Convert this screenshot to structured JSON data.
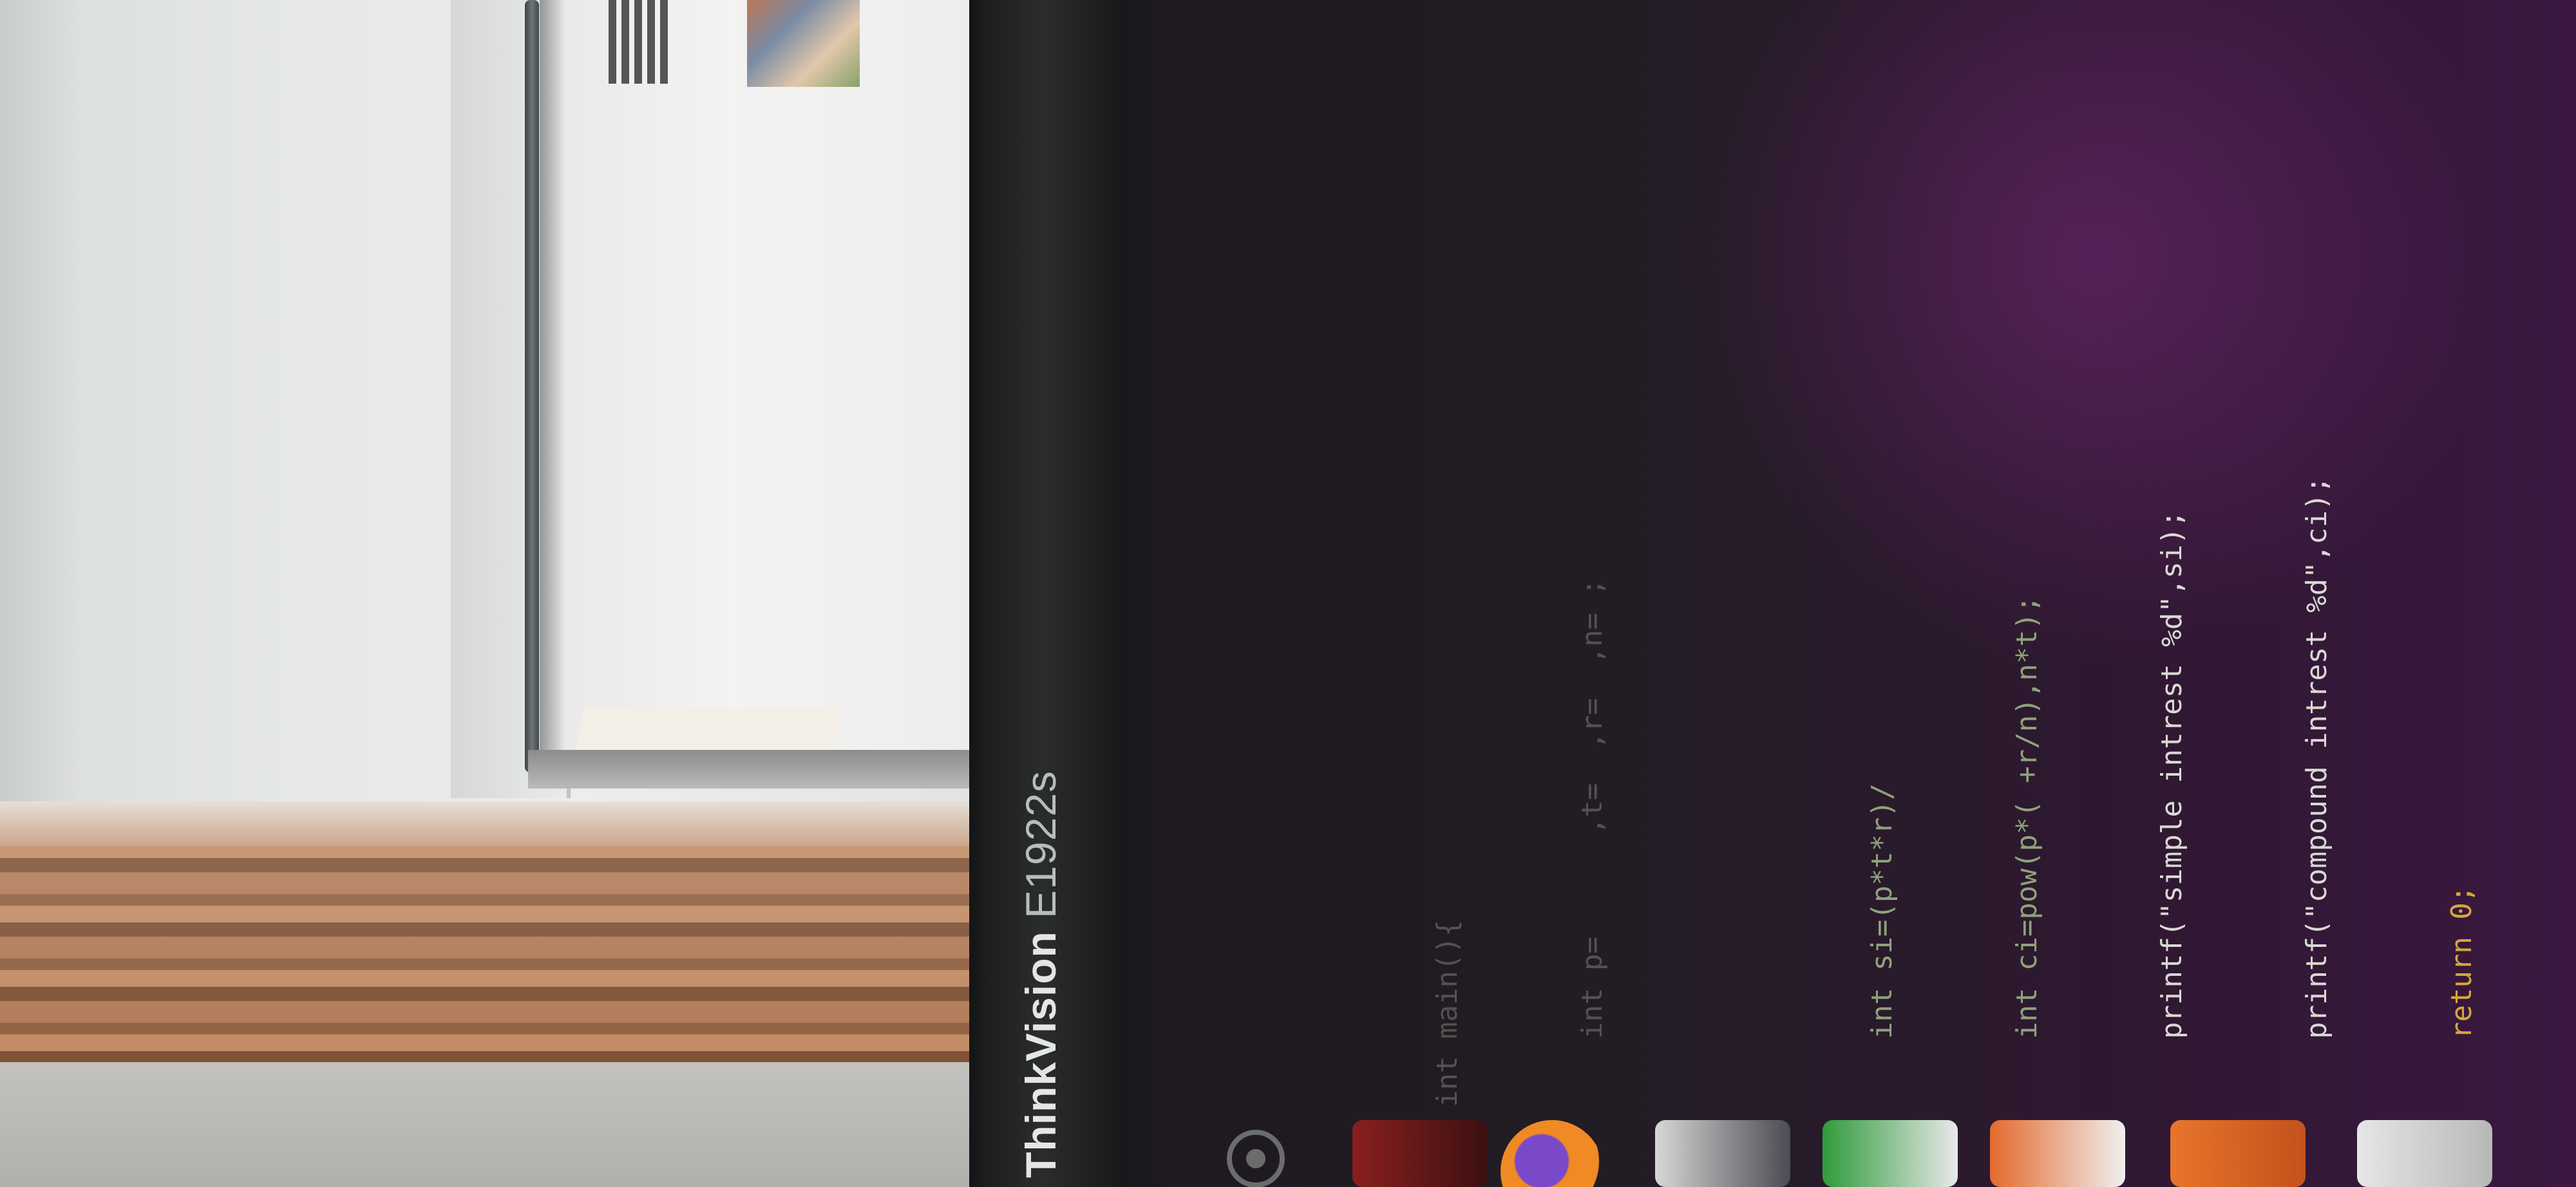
{
  "monitor": {
    "brand_bold": "ThinkVision",
    "model": "E1922s"
  },
  "code": {
    "lines": [
      "int main(){",
      "    int p=      ,t=  ,r=  ,n= ;",
      "",
      "    int si=(p*t*r)/",
      "    int ci=pow(p*( +r/n),n*t);",
      "    printf(\"simple intrest %d\",si);",
      "    printf(\"compound intrest %d\",ci);",
      "    return 0;",
      "}"
    ]
  },
  "dock": {
    "icons": [
      "ubuntu-icon",
      "files-icon",
      "firefox-icon",
      "calculator-icon",
      "spreadsheet-icon",
      "presentation-icon",
      "software-icon"
    ]
  },
  "colors": {
    "screen_bg": "#231c25",
    "keyword": "#8fa27a",
    "return": "#d4a93c",
    "format": "#e88a62"
  }
}
